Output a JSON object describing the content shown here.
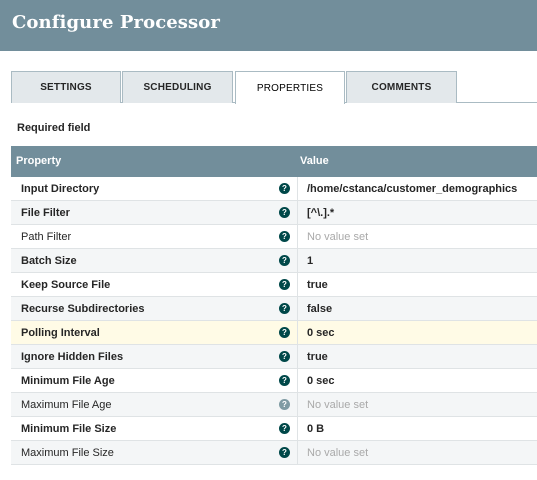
{
  "window": {
    "title": "Configure Processor"
  },
  "tabs": [
    {
      "label": "SETTINGS",
      "active": false
    },
    {
      "label": "SCHEDULING",
      "active": false
    },
    {
      "label": "PROPERTIES",
      "active": true
    },
    {
      "label": "COMMENTS",
      "active": false
    }
  ],
  "required_label": "Required field",
  "table": {
    "headers": {
      "property": "Property",
      "value": "Value"
    },
    "rows": [
      {
        "property": "Input Directory",
        "value": "/home/cstanca/customer_demographics",
        "required": true,
        "empty": false
      },
      {
        "property": "File Filter",
        "value": "[^\\.].*",
        "required": true,
        "empty": false
      },
      {
        "property": "Path Filter",
        "value": "No value set",
        "required": false,
        "empty": true
      },
      {
        "property": "Batch Size",
        "value": "1",
        "required": true,
        "empty": false
      },
      {
        "property": "Keep Source File",
        "value": "true",
        "required": true,
        "empty": false
      },
      {
        "property": "Recurse Subdirectories",
        "value": "false",
        "required": true,
        "empty": false
      },
      {
        "property": "Polling Interval",
        "value": "0 sec",
        "required": true,
        "empty": false,
        "highlighted": true
      },
      {
        "property": "Ignore Hidden Files",
        "value": "true",
        "required": true,
        "empty": false
      },
      {
        "property": "Minimum File Age",
        "value": "0 sec",
        "required": true,
        "empty": false
      },
      {
        "property": "Maximum File Age",
        "value": "No value set",
        "required": false,
        "empty": true
      },
      {
        "property": "Minimum File Size",
        "value": "0 B",
        "required": true,
        "empty": false
      },
      {
        "property": "Maximum File Size",
        "value": "No value set",
        "required": false,
        "empty": true
      }
    ]
  },
  "icons": {
    "help": "question-circle-icon"
  },
  "colors": {
    "header": "#728e9b",
    "highlight_row": "#fffbe6",
    "help_icon": "#004849"
  }
}
